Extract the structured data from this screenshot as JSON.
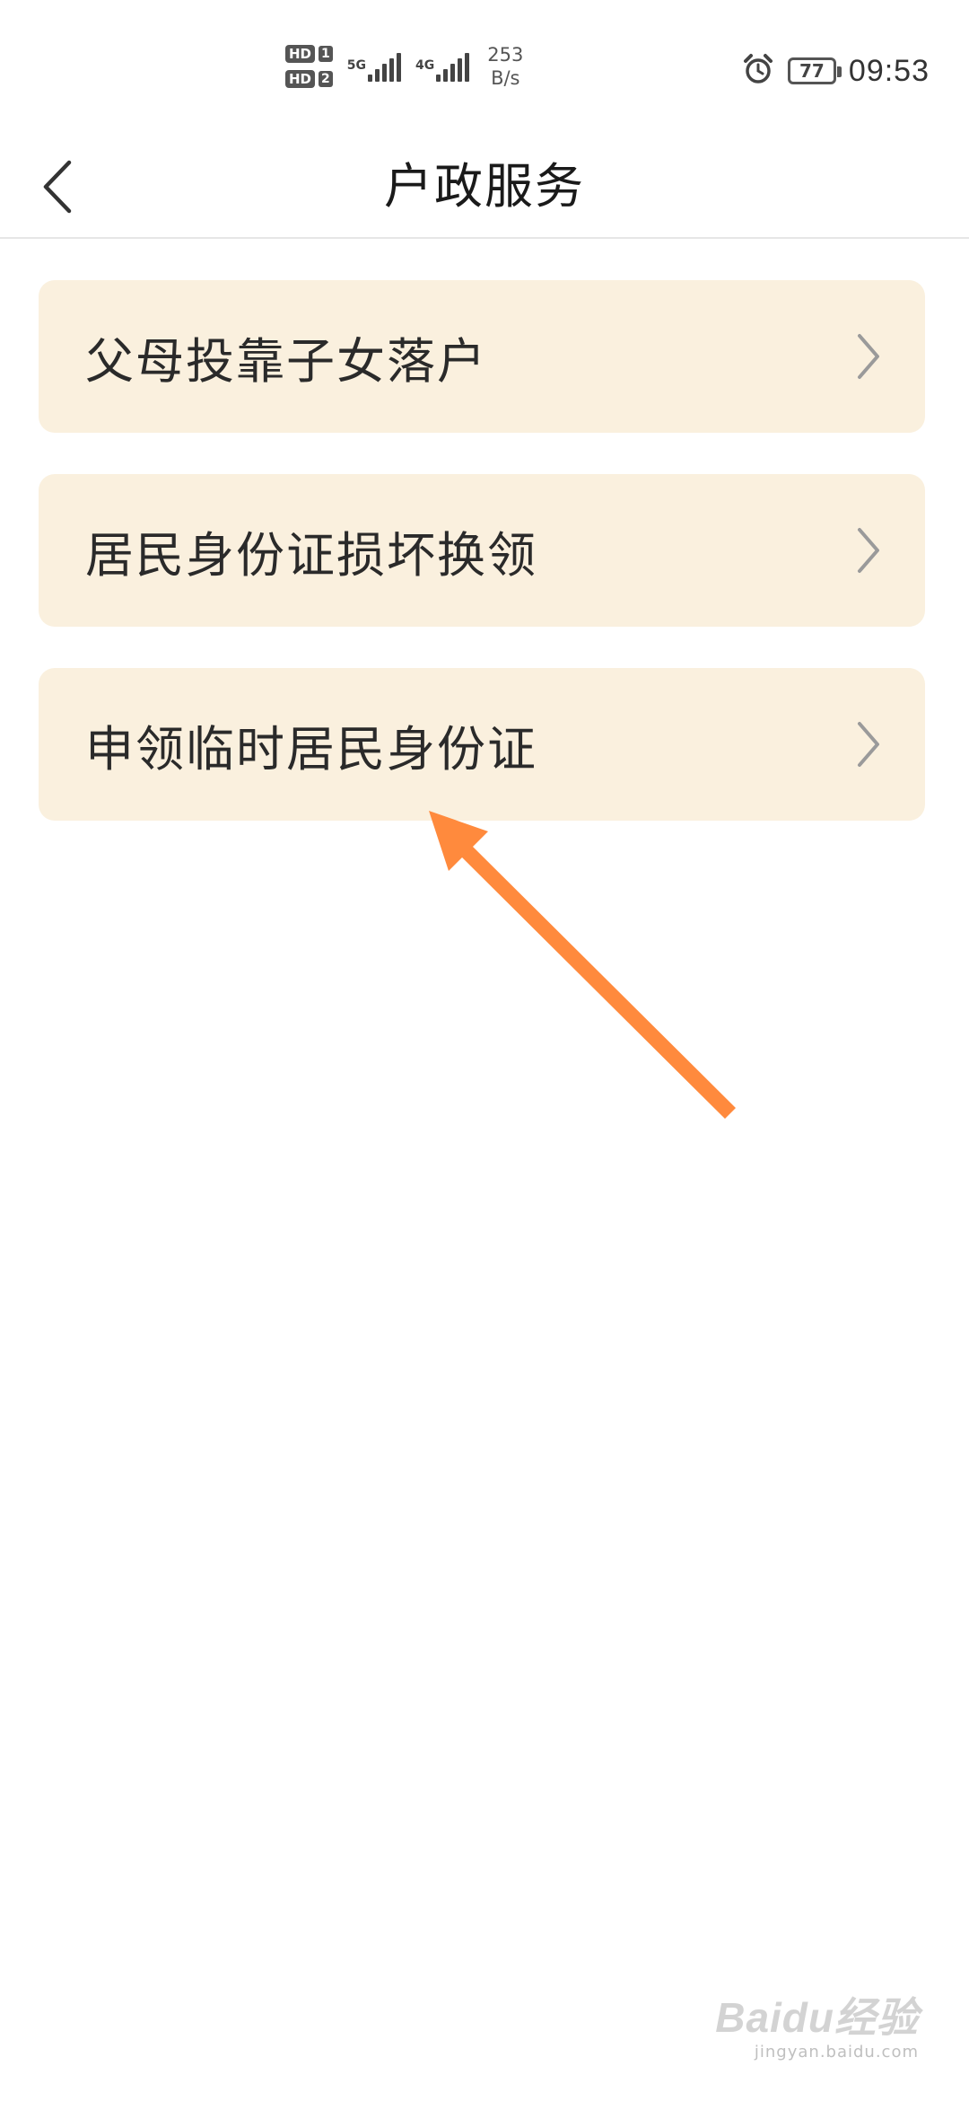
{
  "status_bar": {
    "sim1_label": "HD",
    "sim1_num": "1",
    "sim2_label": "HD",
    "sim2_num": "2",
    "network_1": "5G",
    "network_2": "4G",
    "speed_value": "253",
    "speed_unit": "B/s",
    "battery_level": "77",
    "time": "09:53"
  },
  "header": {
    "title": "户政服务"
  },
  "services": [
    {
      "label": "父母投靠子女落户"
    },
    {
      "label": "居民身份证损坏换领"
    },
    {
      "label": "申领临时居民身份证"
    }
  ],
  "watermark": {
    "logo": "Baidu经验",
    "url": "jingyan.baidu.com"
  },
  "colors": {
    "item_bg": "#faf0de",
    "arrow": "#ff8a3d",
    "chevron": "#9a9a9a"
  }
}
